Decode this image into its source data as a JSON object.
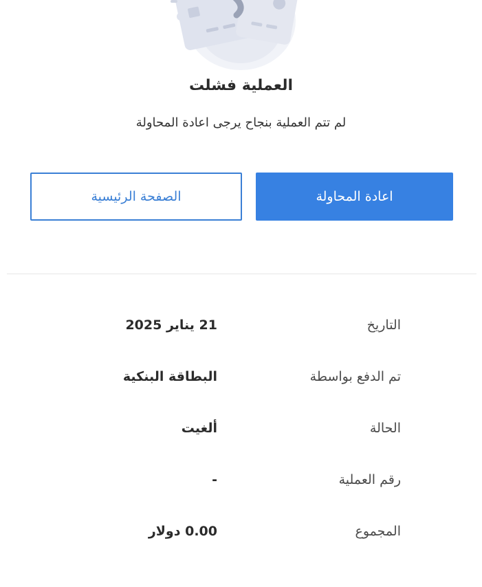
{
  "header": {
    "title": "العملية فشلت",
    "message": "لم تتم العملية بنجاح يرجى اعادة المحاولة"
  },
  "actions": {
    "retry_label": "اعادة المحاولة",
    "home_label": "الصفحة الرئيسية"
  },
  "details": {
    "rows": [
      {
        "label": "التاريخ",
        "value": "21 يناير 2025"
      },
      {
        "label": "تم الدفع بواسطة",
        "value": "البطاقة البنكية"
      },
      {
        "label": "الحالة",
        "value": "ألغيت"
      },
      {
        "label": "رقم العملية",
        "value": "-"
      },
      {
        "label": "المجموع",
        "value": "0.00 دولار"
      }
    ]
  },
  "colors": {
    "primary": "#3781e2",
    "secondary_border": "#3a7fd5",
    "text": "#2b2b2b"
  },
  "icons": {
    "illustration": "failed-card-illustration-icon"
  }
}
